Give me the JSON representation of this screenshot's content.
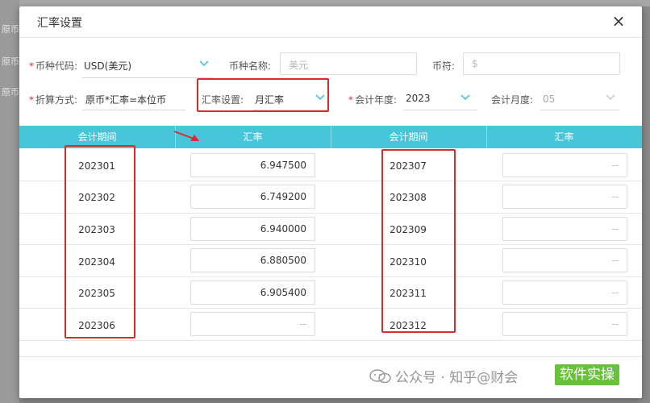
{
  "background": {
    "rows": [
      "原币",
      "原币",
      "原币"
    ]
  },
  "dialog": {
    "title": "汇率设置",
    "close_label": "×"
  },
  "form": {
    "currency_code": {
      "label": "币种代码:",
      "value": "USD(美元)"
    },
    "currency_name": {
      "label": "币种名称:",
      "placeholder": "美元"
    },
    "symbol": {
      "label": "币符:",
      "placeholder": "$"
    },
    "conversion_method": {
      "label": "折算方式:",
      "value": "原币*汇率=本位币"
    },
    "rate_setting": {
      "label": "汇率设置:",
      "value": "月汇率"
    },
    "fiscal_year": {
      "label": "会计年度:",
      "value": "2023"
    },
    "fiscal_month": {
      "label": "会计月度:",
      "value": "05"
    }
  },
  "table": {
    "headers": [
      "会计期间",
      "汇率",
      "会计期间",
      "汇率"
    ],
    "left": [
      {
        "period": "202301",
        "rate": "6.947500"
      },
      {
        "period": "202302",
        "rate": "6.749200"
      },
      {
        "period": "202303",
        "rate": "6.940000"
      },
      {
        "period": "202304",
        "rate": "6.880500"
      },
      {
        "period": "202305",
        "rate": "6.905400"
      },
      {
        "period": "202306",
        "rate": "--"
      }
    ],
    "right": [
      {
        "period": "202307",
        "rate": "--"
      },
      {
        "period": "202308",
        "rate": "--"
      },
      {
        "period": "202309",
        "rate": "--"
      },
      {
        "period": "202310",
        "rate": "--"
      },
      {
        "period": "202311",
        "rate": "--"
      },
      {
        "period": "202312",
        "rate": "--"
      }
    ]
  },
  "watermark": {
    "text": "公众号 · 知乎@财会",
    "tag": "软件实操"
  },
  "colors": {
    "header_bg": "#48c6d9",
    "highlight": "#d92b2b",
    "required": "#e23",
    "tag_green": "#67c23a"
  },
  "icons": [
    "close-icon",
    "chevron-down-icon",
    "arrow-annotation-icon",
    "wechat-icon"
  ]
}
